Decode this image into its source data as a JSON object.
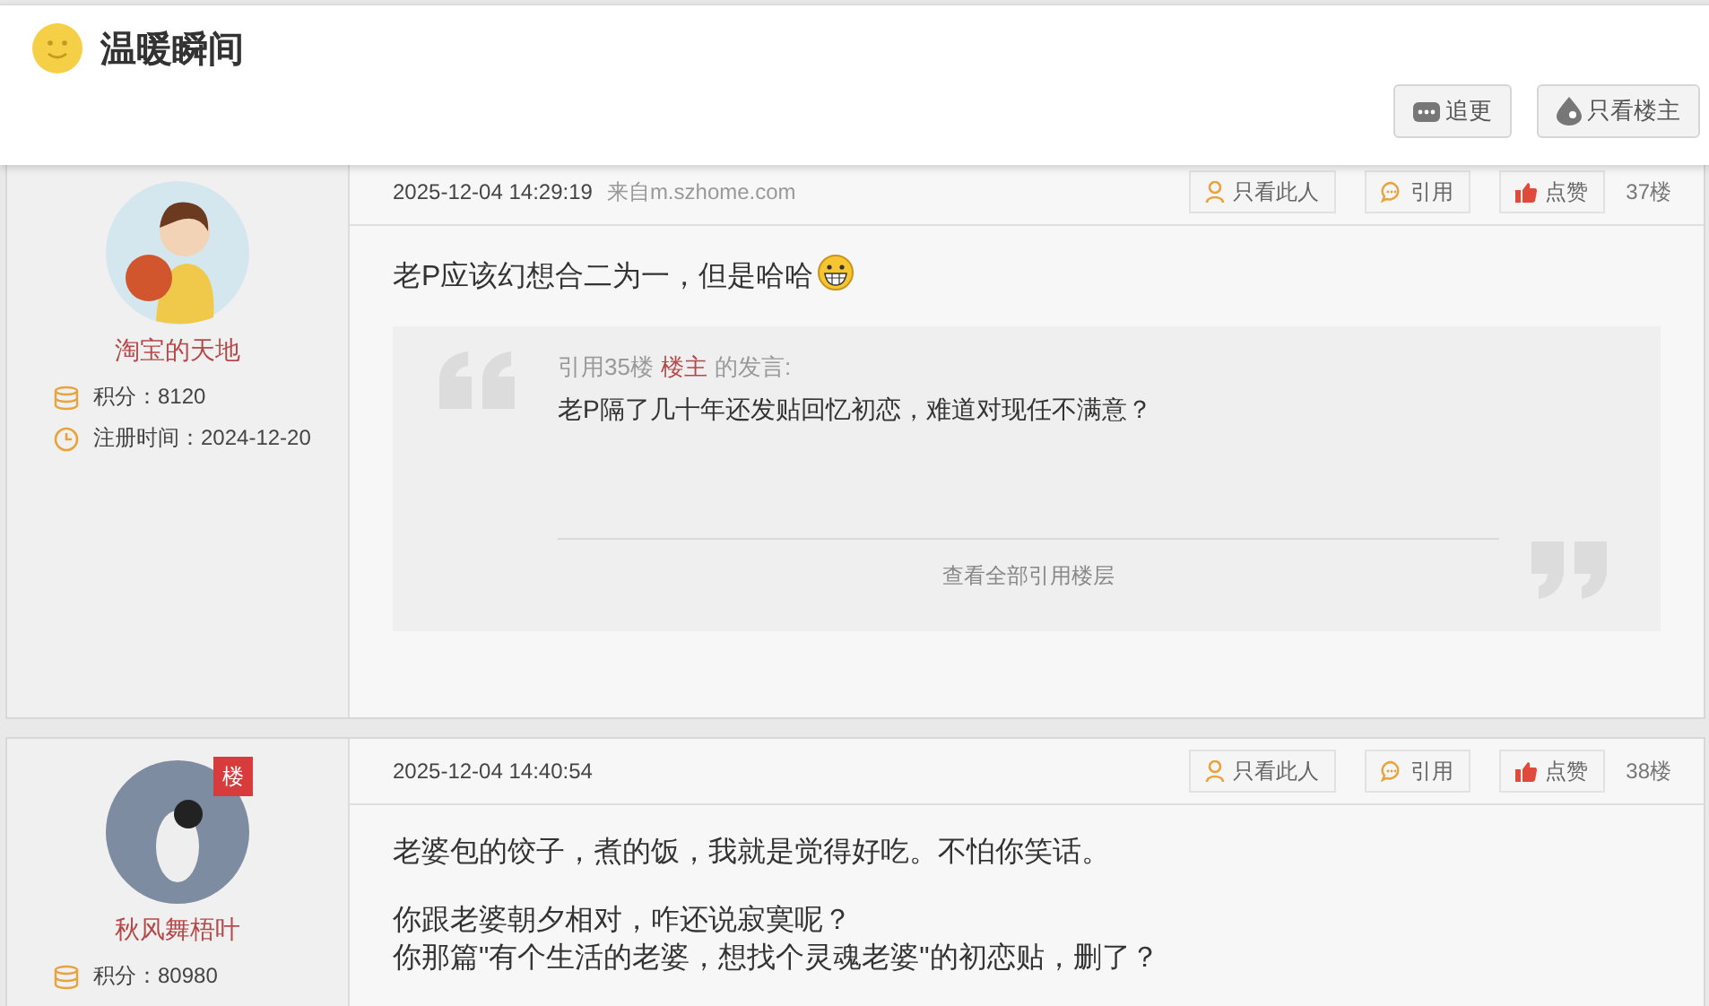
{
  "header": {
    "title": "温暖瞬间",
    "buttons": [
      {
        "kind": "follow",
        "label": "追更"
      },
      {
        "kind": "op_only",
        "label": "只看楼主"
      }
    ]
  },
  "posts": [
    {
      "user": {
        "name": "淘宝的天地",
        "avatar": {
          "kind": "cartoon"
        },
        "stats": [
          {
            "kind": "points",
            "text": "积分：8120"
          },
          {
            "kind": "registered",
            "text": "注册时间：2024-12-20"
          }
        ]
      },
      "time": "2025-12-04 14:29:19",
      "source": "来自m.szhome.com",
      "actions": [
        {
          "kind": "only_this",
          "label": "只看此人"
        },
        {
          "kind": "quote",
          "label": "引用"
        },
        {
          "kind": "like",
          "label": "点赞"
        }
      ],
      "floor": "37楼",
      "content": [
        {
          "kind": "paragraph",
          "lines": [
            "老P应该幻想合二为一，但是哈哈"
          ],
          "emoji": true
        },
        {
          "kind": "quote",
          "ref_prefix": "引用35楼",
          "ref_user": "楼主",
          "ref_suffix": "的发言:",
          "text": "老P隔了几十年还发贴回忆初恋，难道对现任不满意？",
          "more": "查看全部引用楼层"
        }
      ]
    },
    {
      "user": {
        "name": "秋风舞梧叶",
        "avatar": {
          "kind": "photo"
        },
        "badge": "楼",
        "stats": [
          {
            "kind": "points",
            "text": "积分：80980"
          }
        ]
      },
      "time": "2025-12-04 14:40:54",
      "actions": [
        {
          "kind": "only_this",
          "label": "只看此人"
        },
        {
          "kind": "quote",
          "label": "引用"
        },
        {
          "kind": "like",
          "label": "点赞"
        }
      ],
      "floor": "38楼",
      "content": [
        {
          "kind": "paragraph",
          "lines": [
            "老婆包的饺子，煮的饭，我就是觉得好吃。不怕你笑话。"
          ]
        },
        {
          "kind": "paragraph",
          "lines": [
            "你跟老婆朝夕相对，咋还说寂寞呢？",
            "你那篇\"有个生活的老婆，想找个灵魂老婆\"的初恋贴，删了？"
          ]
        }
      ]
    }
  ]
}
